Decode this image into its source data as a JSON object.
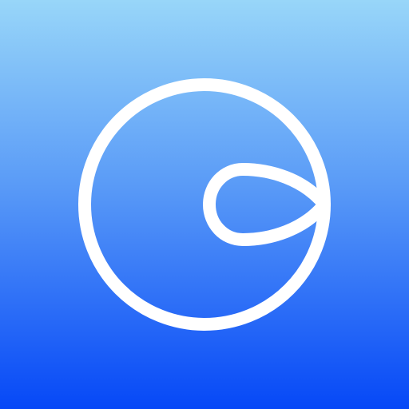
{
  "app_icon": {
    "icon": "circle-with-teardrop-loop-logo-icon",
    "colors": {
      "gradient_top": "#98D6F9",
      "gradient_mid": "#5A9BF7",
      "gradient_bottom": "#0648F7",
      "logo_stroke": "#FFFFFF"
    }
  }
}
